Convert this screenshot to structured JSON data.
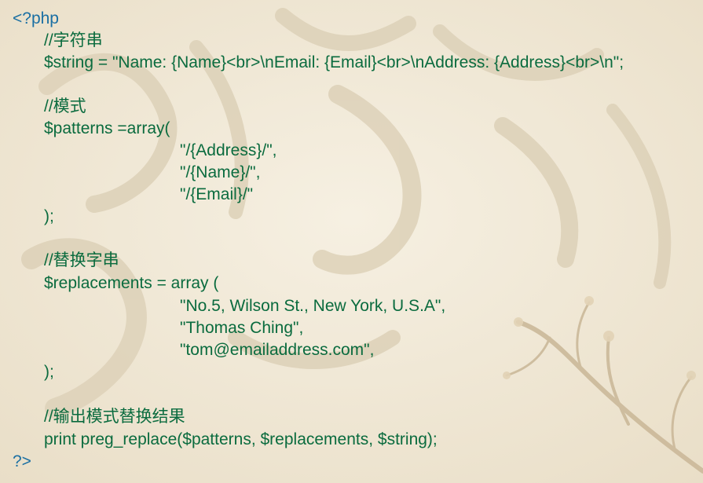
{
  "background": {
    "base_color": "#f3ecdc",
    "ink_color": "#d8ccb3",
    "decoration": "faint-ink-calligraphy-and-plum-branch"
  },
  "colors": {
    "code_text": "#0a6b3e",
    "php_tag": "#1a6fa3"
  },
  "code": {
    "open_tag": "<?php",
    "comment_string": "//字符串",
    "string_assign": "$string = \"Name: {Name}<br>\\nEmail: {Email}<br>\\nAddress: {Address}<br>\\n\";",
    "comment_patterns": "//模式",
    "patterns_open": "$patterns =array(",
    "pattern_1": "\"/{Address}/\",",
    "pattern_2": "\"/{Name}/\",",
    "pattern_3": "\"/{Email}/\"",
    "patterns_close": ");",
    "comment_replacements": "//替换字串",
    "replacements_open": "$replacements = array (",
    "replacement_1": "\"No.5, Wilson St., New York, U.S.A\",",
    "replacement_2": "\"Thomas Ching\",",
    "replacement_3": "\"tom@emailaddress.com\",",
    "replacements_close": ");",
    "comment_output": "//输出模式替换结果",
    "print_statement": "print preg_replace($patterns, $replacements, $string);",
    "close_tag": "?>"
  }
}
